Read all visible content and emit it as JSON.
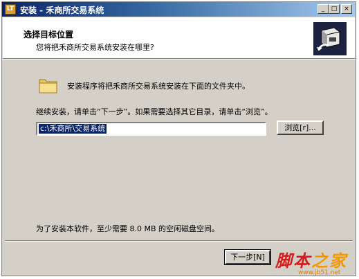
{
  "window": {
    "title": "安装 - 禾商所交易系统",
    "controls": {
      "minimize": "_",
      "maximize": "□",
      "close": "×"
    }
  },
  "header": {
    "title": "选择目标位置",
    "subtitle": "您将把禾商所交易系统安装在哪里?"
  },
  "body": {
    "intro": "安装程序将把禾商所交易系统安装在下面的文件夹中。",
    "instruction": "继续安装，请单击“下一步”。如果需要选择其它目录，请单击“浏览”。",
    "path_value": "c:\\禾商所\\交易系统",
    "browse_label": "浏览[r]...",
    "space_note": "为了安装本软件，至少需要 8.0 MB 的空闲磁盘空间。"
  },
  "footer": {
    "next_label": "下一步[N]"
  },
  "watermark": {
    "text": "脚本之家",
    "url": "www.jb51.net"
  },
  "colors": {
    "title_gradient_start": "#0a246a",
    "dialog_bg": "#d4d0c8",
    "selection": "#0a246a"
  },
  "icons": [
    "app-installer-icon",
    "setup-computer-icon",
    "folder-icon"
  ]
}
